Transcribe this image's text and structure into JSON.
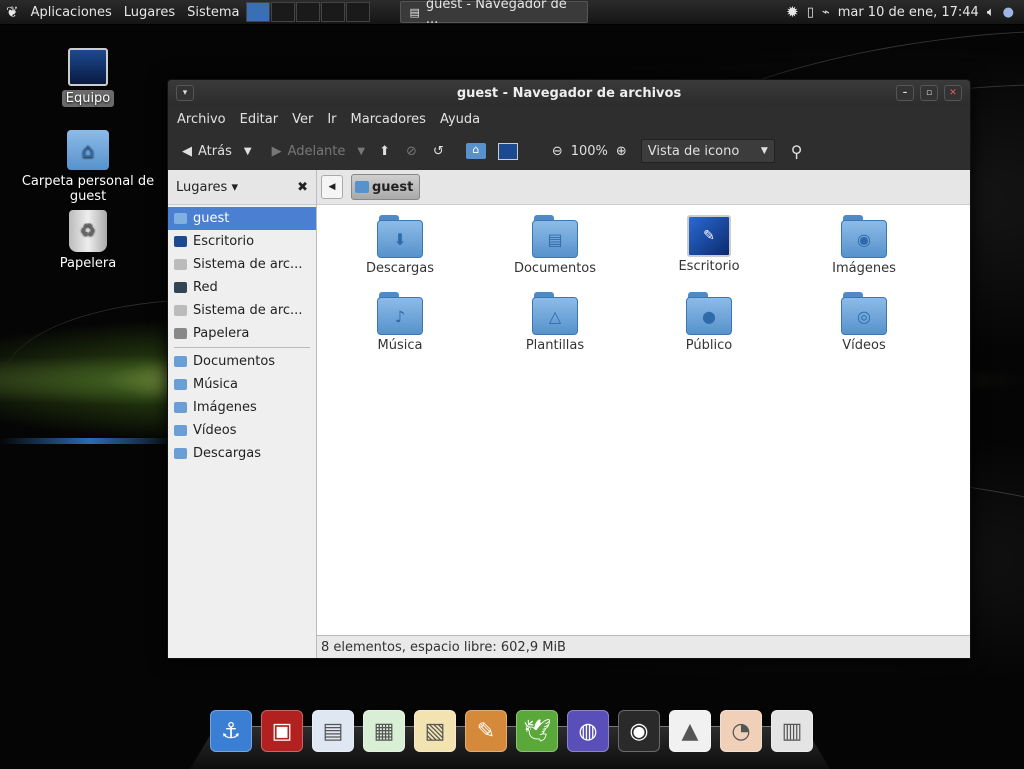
{
  "top_panel": {
    "menus": [
      "Aplicaciones",
      "Lugares",
      "Sistema"
    ],
    "window_button": "guest - Navegador de ...",
    "clock": "mar 10 de ene, 17:44"
  },
  "desktop_icons": [
    {
      "label": "Equipo",
      "selected": true
    },
    {
      "label": "Carpeta personal de guest",
      "selected": false
    },
    {
      "label": "Papelera",
      "selected": false
    }
  ],
  "window": {
    "title": "guest - Navegador de archivos",
    "menu": [
      "Archivo",
      "Editar",
      "Ver",
      "Ir",
      "Marcadores",
      "Ayuda"
    ],
    "toolbar": {
      "back": "Atrás",
      "forward": "Adelante",
      "zoom": "100%",
      "view_mode": "Vista de icono"
    },
    "sidebar": {
      "header": "Lugares",
      "places": [
        {
          "label": "guest",
          "icon": "home-folder-icon",
          "selected": true
        },
        {
          "label": "Escritorio",
          "icon": "desktop-icon"
        },
        {
          "label": "Sistema de arc...",
          "icon": "drive-icon"
        },
        {
          "label": "Red",
          "icon": "network-icon"
        },
        {
          "label": "Sistema de arc...",
          "icon": "drive-icon"
        },
        {
          "label": "Papelera",
          "icon": "trash-icon"
        }
      ],
      "bookmarks": [
        {
          "label": "Documentos",
          "icon": "documents-folder-icon"
        },
        {
          "label": "Música",
          "icon": "music-folder-icon"
        },
        {
          "label": "Imágenes",
          "icon": "pictures-folder-icon"
        },
        {
          "label": "Vídeos",
          "icon": "videos-folder-icon"
        },
        {
          "label": "Descargas",
          "icon": "downloads-folder-icon"
        }
      ]
    },
    "path": "guest",
    "files": [
      {
        "label": "Descargas",
        "glyph": "⬇"
      },
      {
        "label": "Documentos",
        "glyph": "▤"
      },
      {
        "label": "Escritorio",
        "glyph": ""
      },
      {
        "label": "Imágenes",
        "glyph": "◉"
      },
      {
        "label": "Música",
        "glyph": "♪"
      },
      {
        "label": "Plantillas",
        "glyph": "△"
      },
      {
        "label": "Público",
        "glyph": "●"
      },
      {
        "label": "Vídeos",
        "glyph": "◎"
      }
    ],
    "status": "8 elementos, espacio libre: 602,9 MiB"
  },
  "dock": [
    {
      "icon": "anchor-icon",
      "color": "#3b7fd4",
      "glyph": "⚓"
    },
    {
      "icon": "terminal-icon",
      "color": "#b32020",
      "glyph": "▣"
    },
    {
      "icon": "writer-icon",
      "color": "#dfe8f2",
      "glyph": "▤"
    },
    {
      "icon": "calc-icon",
      "color": "#d9efd5",
      "glyph": "▦"
    },
    {
      "icon": "impress-icon",
      "color": "#f3e3b0",
      "glyph": "▧"
    },
    {
      "icon": "paint-icon",
      "color": "#d48a3a",
      "glyph": "✎"
    },
    {
      "icon": "bird-icon",
      "color": "#5aa83a",
      "glyph": "🕊"
    },
    {
      "icon": "globe-icon",
      "color": "#5a4fb8",
      "glyph": "◍"
    },
    {
      "icon": "speaker-icon",
      "color": "#2a2a2a",
      "glyph": "◉"
    },
    {
      "icon": "vlc-icon",
      "color": "#f1f1f1",
      "glyph": "▲"
    },
    {
      "icon": "eye-icon",
      "color": "#f0d0b8",
      "glyph": "◔"
    },
    {
      "icon": "cabinet-icon",
      "color": "#e4e4e4",
      "glyph": "▥"
    }
  ]
}
